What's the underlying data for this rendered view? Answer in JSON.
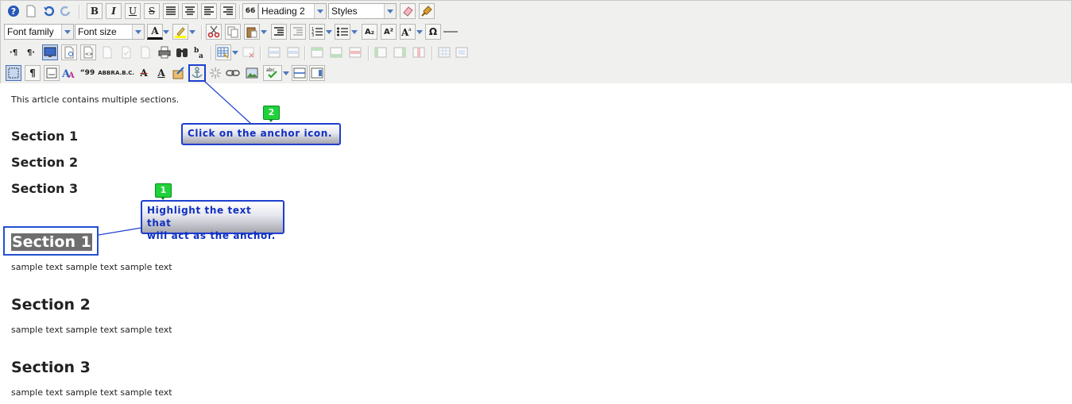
{
  "toolbar": {
    "row1": {
      "format_select": "Heading 2",
      "styles_select": "Styles",
      "icons": [
        "help-icon",
        "new-document-icon",
        "undo-icon",
        "redo-icon",
        "bold-icon",
        "italic-icon",
        "underline-icon",
        "strikethrough-icon",
        "justify-full-icon",
        "align-center-icon",
        "align-left-icon",
        "align-right-icon",
        "blockquote-icon",
        "remove-format-icon",
        "cleanup-icon"
      ]
    },
    "row2": {
      "font_family_select": "Font family",
      "font_size_select": "Font size",
      "icons": [
        "font-color-icon",
        "highlight-icon",
        "cut-icon",
        "copy-icon",
        "paste-icon",
        "indent-icon",
        "outdent-icon",
        "numbered-list-icon",
        "bullet-list-icon",
        "subscript-icon",
        "superscript-icon",
        "font-size-icon",
        "special-char-icon",
        "horizontal-rule-icon"
      ]
    },
    "glyphs": {
      "help": "?",
      "bold": "B",
      "italic": "I",
      "underline": "U",
      "strike": "S",
      "quote": "66",
      "omega": "Ω",
      "subscript": "A₂",
      "superscript": "A²",
      "fontcolor": "A",
      "pilcrow": "¶",
      "ltr": "·¶",
      "rtl": "¶·",
      "quote2": "“99",
      "abbr": "ABBR",
      "acronym": "A.B.C.",
      "del": "A",
      "ins": "A",
      "abc": "abc"
    }
  },
  "editor": {
    "intro": "This article contains multiple sections.",
    "toc": [
      "Section 1",
      "Section 2",
      "Section 3"
    ],
    "sections": [
      {
        "heading": "Section 1",
        "body": "sample text sample text sample text"
      },
      {
        "heading": "Section 2",
        "body": "sample text sample text sample text"
      },
      {
        "heading": "Section 3",
        "body": "sample text sample text sample text"
      }
    ]
  },
  "callouts": [
    {
      "number": "2",
      "text": "Click on the anchor icon."
    },
    {
      "number": "1",
      "line1": "Highlight the text that",
      "line2": "will act as the anchor."
    }
  ],
  "colors": {
    "callout_border": "#1f3fcf",
    "badge": "#1fd23a",
    "toolbar_bg": "#f0f0ee"
  }
}
